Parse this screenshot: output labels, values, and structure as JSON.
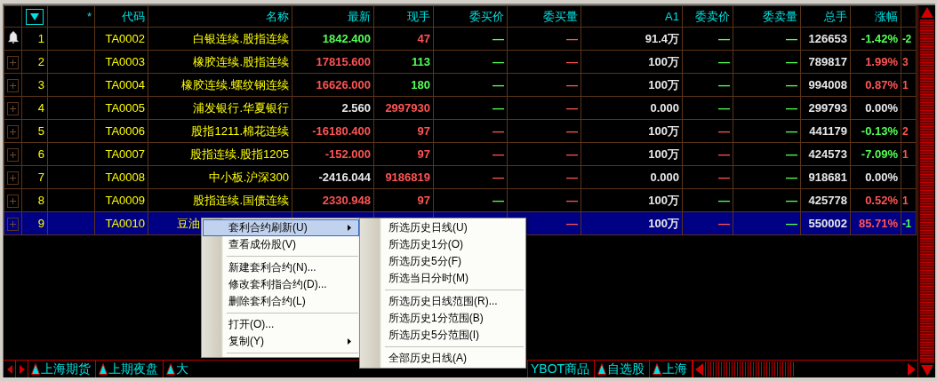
{
  "columns": [
    "*",
    "代码",
    "名称",
    "最新",
    "现手",
    "委买价",
    "委买量",
    "A1",
    "委卖价",
    "委卖量",
    "总手",
    "涨幅"
  ],
  "rows": [
    {
      "no": "1",
      "code": "TA0002",
      "name": "白银连续.股指连续",
      "selected": false,
      "alert": true,
      "cells": [
        {
          "text": "1842.400",
          "color": "#54ff54"
        },
        {
          "text": "47",
          "color": "#ff5454"
        },
        {
          "text": "—",
          "color": "#54ff54"
        },
        {
          "text": "—",
          "color": "#ff5454"
        },
        {
          "text": "91.4万",
          "color": "#e8e8e8"
        },
        {
          "text": "—",
          "color": "#54ff54"
        },
        {
          "text": "—",
          "color": "#54ff54"
        },
        {
          "text": "126653",
          "color": "#e8e8e8"
        },
        {
          "text": "-1.42%",
          "color": "#54ff54"
        },
        {
          "text": "-2",
          "color": "#54ff54"
        }
      ]
    },
    {
      "no": "2",
      "code": "TA0003",
      "name": "橡胶连续.股指连续",
      "selected": false,
      "alert": false,
      "cells": [
        {
          "text": "17815.600",
          "color": "#ff5454"
        },
        {
          "text": "113",
          "color": "#54ff54"
        },
        {
          "text": "—",
          "color": "#54ff54"
        },
        {
          "text": "—",
          "color": "#ff5454"
        },
        {
          "text": "100万",
          "color": "#e8e8e8"
        },
        {
          "text": "—",
          "color": "#54ff54"
        },
        {
          "text": "—",
          "color": "#54ff54"
        },
        {
          "text": "789817",
          "color": "#e8e8e8"
        },
        {
          "text": "1.99%",
          "color": "#ff5454"
        },
        {
          "text": "3",
          "color": "#ff5454"
        }
      ]
    },
    {
      "no": "3",
      "code": "TA0004",
      "name": "橡胶连续.螺纹钢连续",
      "selected": false,
      "alert": false,
      "cells": [
        {
          "text": "16626.000",
          "color": "#ff5454"
        },
        {
          "text": "180",
          "color": "#54ff54"
        },
        {
          "text": "—",
          "color": "#54ff54"
        },
        {
          "text": "—",
          "color": "#ff5454"
        },
        {
          "text": "100万",
          "color": "#e8e8e8"
        },
        {
          "text": "—",
          "color": "#54ff54"
        },
        {
          "text": "—",
          "color": "#54ff54"
        },
        {
          "text": "994008",
          "color": "#e8e8e8"
        },
        {
          "text": "0.87%",
          "color": "#ff5454"
        },
        {
          "text": "1",
          "color": "#ff5454"
        }
      ]
    },
    {
      "no": "4",
      "code": "TA0005",
      "name": "浦发银行.华夏银行",
      "selected": false,
      "alert": false,
      "cells": [
        {
          "text": "2.560",
          "color": "#e8e8e8"
        },
        {
          "text": "2997930",
          "color": "#ff5454"
        },
        {
          "text": "—",
          "color": "#54ff54"
        },
        {
          "text": "—",
          "color": "#ff5454"
        },
        {
          "text": "0.000",
          "color": "#e8e8e8"
        },
        {
          "text": "—",
          "color": "#54ff54"
        },
        {
          "text": "—",
          "color": "#54ff54"
        },
        {
          "text": "299793",
          "color": "#e8e8e8"
        },
        {
          "text": "0.00%",
          "color": "#e8e8e8"
        },
        null
      ]
    },
    {
      "no": "5",
      "code": "TA0006",
      "name": "股指1211.棉花连续",
      "selected": false,
      "alert": false,
      "cells": [
        {
          "text": "-16180.400",
          "color": "#ff5454"
        },
        {
          "text": "97",
          "color": "#ff5454"
        },
        {
          "text": "—",
          "color": "#ff5454"
        },
        {
          "text": "—",
          "color": "#ff5454"
        },
        {
          "text": "100万",
          "color": "#e8e8e8"
        },
        {
          "text": "—",
          "color": "#ff5454"
        },
        {
          "text": "—",
          "color": "#54ff54"
        },
        {
          "text": "441179",
          "color": "#e8e8e8"
        },
        {
          "text": "-0.13%",
          "color": "#54ff54"
        },
        {
          "text": "2",
          "color": "#ff5454"
        }
      ]
    },
    {
      "no": "6",
      "code": "TA0007",
      "name": "股指连续.股指1205",
      "selected": false,
      "alert": false,
      "cells": [
        {
          "text": "-152.000",
          "color": "#ff5454"
        },
        {
          "text": "97",
          "color": "#ff5454"
        },
        {
          "text": "—",
          "color": "#ff5454"
        },
        {
          "text": "—",
          "color": "#ff5454"
        },
        {
          "text": "100万",
          "color": "#e8e8e8"
        },
        {
          "text": "—",
          "color": "#ff5454"
        },
        {
          "text": "—",
          "color": "#54ff54"
        },
        {
          "text": "424573",
          "color": "#e8e8e8"
        },
        {
          "text": "-7.09%",
          "color": "#54ff54"
        },
        {
          "text": "1",
          "color": "#ff5454"
        }
      ]
    },
    {
      "no": "7",
      "code": "TA0008",
      "name": "中小板.沪深300",
      "selected": false,
      "alert": false,
      "cells": [
        {
          "text": "-2416.044",
          "color": "#e8e8e8"
        },
        {
          "text": "9186819",
          "color": "#ff5454"
        },
        {
          "text": "—",
          "color": "#ff5454"
        },
        {
          "text": "—",
          "color": "#ff5454"
        },
        {
          "text": "0.000",
          "color": "#e8e8e8"
        },
        {
          "text": "—",
          "color": "#ff5454"
        },
        {
          "text": "—",
          "color": "#54ff54"
        },
        {
          "text": "918681",
          "color": "#e8e8e8"
        },
        {
          "text": "0.00%",
          "color": "#e8e8e8"
        },
        null
      ]
    },
    {
      "no": "8",
      "code": "TA0009",
      "name": "股指连续.国债连续",
      "selected": false,
      "alert": false,
      "cells": [
        {
          "text": "2330.948",
          "color": "#ff5454"
        },
        {
          "text": "97",
          "color": "#ff5454"
        },
        {
          "text": "—",
          "color": "#54ff54"
        },
        {
          "text": "—",
          "color": "#ff5454"
        },
        {
          "text": "100万",
          "color": "#e8e8e8"
        },
        {
          "text": "—",
          "color": "#54ff54"
        },
        {
          "text": "—",
          "color": "#54ff54"
        },
        {
          "text": "425778",
          "color": "#e8e8e8"
        },
        {
          "text": "0.52%",
          "color": "#ff5454"
        },
        {
          "text": "1",
          "color": "#ff5454"
        }
      ]
    },
    {
      "no": "9",
      "code": "TA0010",
      "name": "豆油",
      "selected": true,
      "alert": false,
      "cells": [
        null,
        null,
        null,
        {
          "text": "—",
          "color": "#ff5454"
        },
        {
          "text": "100万",
          "color": "#e8e8e8"
        },
        {
          "text": "—",
          "color": "#ff5454"
        },
        {
          "text": "—",
          "color": "#54ff54"
        },
        {
          "text": "550002",
          "color": "#e8e8e8"
        },
        {
          "text": "85.71%",
          "color": "#ff5454"
        },
        {
          "text": "-1",
          "color": "#54ff54"
        }
      ]
    }
  ],
  "context_menu": [
    {
      "kind": "item",
      "label": "套利合约刷新(U)",
      "selected": true,
      "submenu": true
    },
    {
      "kind": "item",
      "label": "查看成份股(V)",
      "selected": false,
      "submenu": false
    },
    {
      "kind": "separator"
    },
    {
      "kind": "item",
      "label": "新建套利合约(N)...",
      "selected": false,
      "submenu": false
    },
    {
      "kind": "item",
      "label": "修改套利指合约(D)...",
      "selected": false,
      "submenu": false
    },
    {
      "kind": "item",
      "label": "删除套利合约(L)",
      "selected": false,
      "submenu": false
    },
    {
      "kind": "separator"
    },
    {
      "kind": "item",
      "label": "打开(O)...",
      "selected": false,
      "submenu": false
    },
    {
      "kind": "item",
      "label": "复制(Y)",
      "selected": false,
      "submenu": true
    },
    {
      "kind": "separator"
    }
  ],
  "submenu": [
    {
      "kind": "item",
      "label": "所选历史日线(U)"
    },
    {
      "kind": "item",
      "label": "所选历史1分(O)"
    },
    {
      "kind": "item",
      "label": "所选历史5分(F)"
    },
    {
      "kind": "item",
      "label": "所选当日分时(M)"
    },
    {
      "kind": "separator"
    },
    {
      "kind": "item",
      "label": "所选历史日线范围(R)..."
    },
    {
      "kind": "item",
      "label": "所选历史1分范围(B)"
    },
    {
      "kind": "item",
      "label": "所选历史5分范围(I)"
    },
    {
      "kind": "separator"
    },
    {
      "kind": "item",
      "label": "全部历史日线(A)"
    }
  ],
  "market_tabs": [
    {
      "label": "上海期货",
      "icon": true
    },
    {
      "label": "上期夜盘",
      "icon": true
    },
    {
      "label": "大",
      "icon": true
    },
    {
      "label": "YBOT商品",
      "icon": false
    },
    {
      "label": "自选股",
      "icon": true
    },
    {
      "label": "上海",
      "icon": true
    }
  ]
}
